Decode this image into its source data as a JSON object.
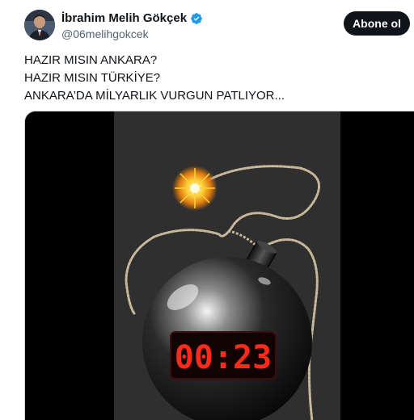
{
  "author": {
    "display_name": "İbrahim Melih Gökçek",
    "handle": "@06melihgokcek",
    "verified": true,
    "verified_color": "#1d9bf0"
  },
  "actions": {
    "follow_label": "Abone ol"
  },
  "tweet": {
    "lines": [
      "HAZIR MISIN ANKARA?",
      "HAZIR MISIN TÜRKİYE?",
      "ANKARA’DA MİLYARLIK VURGUN PATLIYOR..."
    ]
  },
  "media": {
    "timer_text": "00:23",
    "timer_color": "#ff2a1a"
  },
  "icons": {
    "verified": "verified-badge-icon",
    "spark": "spark-icon"
  }
}
